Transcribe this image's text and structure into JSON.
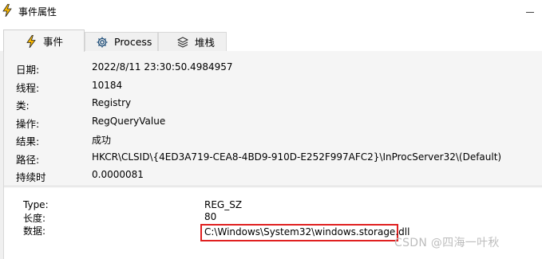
{
  "window": {
    "title": "事件属性",
    "icon": "lightning-icon"
  },
  "tabs": [
    {
      "label": "事件",
      "icon": "lightning-icon",
      "active": true
    },
    {
      "label": "Process",
      "icon": "gear-icon",
      "active": false
    },
    {
      "label": "堆栈",
      "icon": "layers-icon",
      "active": false
    }
  ],
  "properties": [
    {
      "label": "日期:",
      "value": "2022/8/11 23:30:50.4984957"
    },
    {
      "label": "线程:",
      "value": "10184"
    },
    {
      "label": "类:",
      "value": "Registry"
    },
    {
      "label": "操作:",
      "value": "RegQueryValue"
    },
    {
      "label": "结果:",
      "value": "成功"
    },
    {
      "label": "路径:",
      "value": "HKCR\\CLSID\\{4ED3A719-CEA8-4BD9-910D-E252F997AFC2}\\InProcServer32\\(Default)"
    },
    {
      "label": "持续时",
      "value": "0.0000081"
    }
  ],
  "details": [
    {
      "label": "Type:",
      "value": "REG_SZ"
    },
    {
      "label": "长度:",
      "value": "80"
    },
    {
      "label": "数据:",
      "value": "C:\\Windows\\System32\\windows.storage.dll"
    }
  ],
  "colors": {
    "accent_icon": "#f5b400",
    "highlight_border": "#e02020"
  },
  "watermark": "CSDN @四海一叶秋"
}
